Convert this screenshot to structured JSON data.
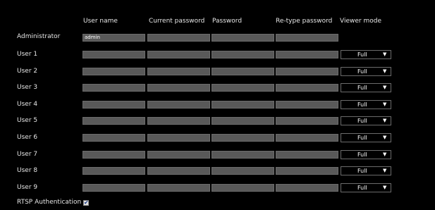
{
  "headers": [
    "User name",
    "Current password",
    "Password",
    "Re-type password",
    "Viewer mode"
  ],
  "admin": {
    "label": "Administrator",
    "username": "admin"
  },
  "users": [
    {
      "label": "User 1",
      "mode": "Full"
    },
    {
      "label": "User 2",
      "mode": "Full"
    },
    {
      "label": "User 3",
      "mode": "Full"
    },
    {
      "label": "User 4",
      "mode": "Full"
    },
    {
      "label": "User 5",
      "mode": "Full"
    },
    {
      "label": "User 6",
      "mode": "Full"
    },
    {
      "label": "User 7",
      "mode": "Full"
    },
    {
      "label": "User 8",
      "mode": "Full"
    },
    {
      "label": "User 9",
      "mode": "Full"
    }
  ],
  "rtsp": {
    "label": "RTSP Authentication",
    "checked": true
  },
  "dropdown_arrow": "▼",
  "check_glyph": "✔"
}
